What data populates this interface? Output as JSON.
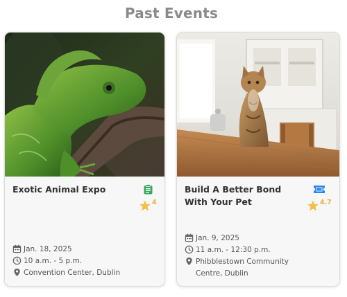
{
  "section": {
    "title": "Past Events"
  },
  "events": [
    {
      "title": "Exotic Animal Expo",
      "type_icon": "clipboard-icon",
      "rating": "4",
      "date": "Jan. 18, 2025",
      "time": "10 a.m. - 5 p.m.",
      "location": "Convention Center, Dublin"
    },
    {
      "title": "Build A Better Bond With Your Pet",
      "type_icon": "ticket-icon",
      "rating": "4.7",
      "date": "Jan. 9, 2025",
      "time": "11 a.m. - 12:30 p.m.",
      "location": "Phibblestown Community Centre, Dublin"
    }
  ],
  "colors": {
    "heading": "#8a8a8a",
    "star": "#f2c04f",
    "type_icon_green": "#3aa55c",
    "type_icon_blue": "#2f86e6"
  }
}
